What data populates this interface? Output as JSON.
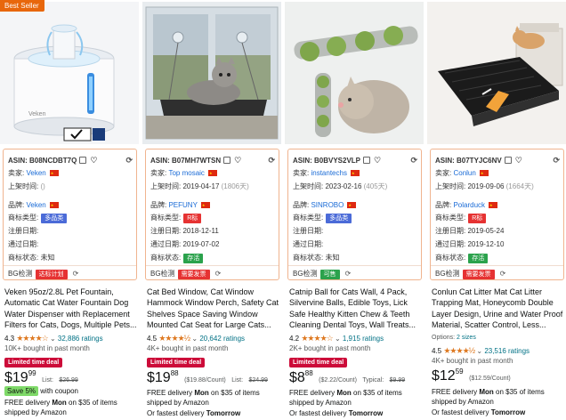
{
  "labels": {
    "seller": "卖家:",
    "listed": "上架时间:",
    "brand": "品牌:",
    "type": "商标类型:",
    "reg_date": "注册日期:",
    "pass_date": "通过日期:",
    "status": "商标状态:",
    "bg": "BG检测",
    "limited_deal": "Limited time deal",
    "free_delivery_prefix": "FREE delivery",
    "free_delivery_suffix": "on $35 of items shipped by Amazon",
    "fastest_prefix": "Or fastest delivery"
  },
  "products": [
    {
      "badge": "Best Seller",
      "asin": "ASIN:  B08NCDBT7Q",
      "seller": "Veken",
      "listed_date": "",
      "listed_days": "()",
      "brand": "Veken",
      "type_tag": "多品类",
      "reg_date": "",
      "pass_date": "",
      "status": "未知",
      "bg_tag": "达标计划",
      "title": "Veken 95oz/2.8L Pet Fountain, Automatic Cat Water Fountain Dog Water Dispenser with Replacement Filters for Cats, Dogs, Multiple Pets...",
      "rating": "4.3",
      "stars": "★★★★☆",
      "ratings_count": "32,886 ratings",
      "bought": "10K+ bought in past month",
      "price_whole": "$19",
      "price_frac": "99",
      "price_extra_label": "List:",
      "price_extra_value": "$26.99",
      "save_badge": "Save 5%",
      "save_text": "with coupon",
      "delivery_day": "Mon",
      "fastest_day": "Tomorrow"
    },
    {
      "badge": "",
      "asin": "ASIN:  B07MH7WTSN",
      "seller": "Top mosaic",
      "listed_date": "2019-04-17",
      "listed_days": "(1806天)",
      "brand": "PEFUNY",
      "type_tag": "R标",
      "reg_date": "2018-12-11",
      "pass_date": "2019-07-02",
      "status": "存活",
      "bg_tag": "需要发票",
      "title": "Cat Bed Window, Cat Window Hammock Window Perch, Safety Cat Shelves Space Saving Window Mounted Cat Seat for Large Cats...",
      "rating": "4.5",
      "stars": "★★★★½",
      "ratings_count": "20,642 ratings",
      "bought": "4K+ bought in past month",
      "price_whole": "$19",
      "price_frac": "88",
      "price_unit": "($19.88/Count)",
      "price_extra_label": "List:",
      "price_extra_value": "$24.99",
      "delivery_day": "Mon",
      "fastest_day": "Tomorrow"
    },
    {
      "badge": "",
      "asin": "ASIN:  B0BVYS2VLP",
      "seller": "instantechs",
      "listed_date": "2023-02-16",
      "listed_days": "(405天)",
      "brand": "SINROBO",
      "type_tag": "多品类",
      "reg_date": "",
      "pass_date": "",
      "status": "未知",
      "bg_tag": "可售",
      "title": "Catnip Ball for Cats Wall, 4 Pack, Silvervine Balls, Edible Toys, Lick Safe Healthy Kitten Chew & Teeth Cleaning Dental Toys, Wall Treats...",
      "rating": "4.2",
      "stars": "★★★★☆",
      "ratings_count": "1,915 ratings",
      "bought": "2K+ bought in past month",
      "price_whole": "$8",
      "price_frac": "88",
      "price_unit": "($2.22/Count)",
      "price_extra_label": "Typical:",
      "price_extra_value": "$9.99",
      "delivery_day": "Mon",
      "fastest_day": "Tomorrow"
    },
    {
      "badge": "",
      "asin": "ASIN:  B07TYJC6NV",
      "seller": "Conlun",
      "listed_date": "2019-09-06",
      "listed_days": "(1664天)",
      "brand": "Polarduck",
      "type_tag": "R标",
      "reg_date": "2019-05-24",
      "pass_date": "2019-12-10",
      "status": "存活",
      "bg_tag": "需要发票",
      "title": "Conlun Cat Litter Mat Cat Litter Trapping Mat, Honeycomb Double Layer Design, Urine and Water Proof Material, Scatter Control, Less...",
      "options_label": "Options:",
      "options_value": "2 sizes",
      "rating": "4.5",
      "stars": "★★★★½",
      "ratings_count": "23,516 ratings",
      "bought": "4K+ bought in past month",
      "price_whole": "$12",
      "price_frac": "59",
      "price_unit": "($12.59/Count)",
      "delivery_day": "Mon",
      "fastest_day": "Tomorrow"
    }
  ]
}
